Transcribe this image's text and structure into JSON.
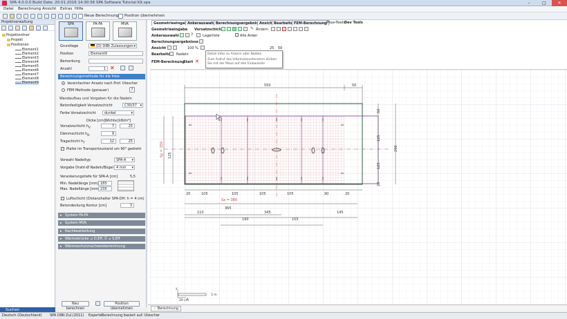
{
  "window": {
    "title": "SPA 4.0.0.0    Build Date: 20.01.2016 14:30:56    SPA Software Tutorial Kit.spa",
    "min": "–",
    "max": "□",
    "close": "✕"
  },
  "menu": [
    "Datei",
    "Berechnung",
    "Ansicht",
    "Extras",
    "Hilfe"
  ],
  "toolbar": {
    "new_calc": "Neue Berechnung",
    "take_position": "Position übernehmen"
  },
  "tree": {
    "header": "Projektverwaltung",
    "root": "Projektordner",
    "project": "Projekt",
    "positions": "Positionen",
    "elements": [
      "Element1",
      "Element2",
      "Element3",
      "Element4",
      "Element5",
      "Element6",
      "Element7",
      "Element8",
      "Element9"
    ]
  },
  "search_label": "Suchen",
  "systems": [
    {
      "label": "SPA"
    },
    {
      "label": "FA-FA"
    },
    {
      "label": "MVA"
    }
  ],
  "form": {
    "grundlage_label": "Grundlage",
    "grundlage_value": "(D) DIBt Zulassungen",
    "position_label": "Position",
    "position_value": "Element9",
    "bemerkung_label": "Bemerkung",
    "anzahl_label": "Anzahl",
    "anzahl_value": "1",
    "method_head": "Berechnungsmethode für die freie Verankerungen",
    "method_opt1": "Vereinfachter Ansatz nach Prof. Utescher",
    "method_opt2": "FEM Methode (genauer)",
    "method_help": "?",
    "wand_head": "Wandaufbau und Vorgaben für die Nadeln",
    "beton_label": "Betonfestigkeit Vorsatzschicht",
    "beton_value": "C30/37",
    "farbe_label": "Farbe Vorsatzschicht",
    "farbe_value": "dunkel",
    "dicke_head": "Dicke [cm]",
    "wichte_head": "Wichte",
    "wichte_unit": "[kN/m³]",
    "vs_label": "Vorsatzschicht   h",
    "vs_sub": "V",
    "vs_dicke": "7",
    "vs_wichte": "25",
    "dd_label": "Dämmschicht   h",
    "dd_sub": "D",
    "dd_dicke": "9",
    "ts_label": "Tragschicht   h",
    "ts_sub": "T",
    "ts_dicke": "12",
    "ts_wichte": "25",
    "platte_label": "Platte im Transportzustand um 90° gedreht",
    "nadeltyp_label": "Vorwahl Nadeltyp",
    "nadeltyp_value": "SPA-A",
    "draht_label": "Vorgabe Draht-Ø  Nadeln/Bügel",
    "draht_value": "4 mm",
    "veran_label": "Verankerungstiefe für SPA-A   [cm]",
    "veran_value": "5,5",
    "min_label": "Min. Nadellänge [mm]",
    "min_value": "185",
    "max_label": "Max. Nadellänge [mm]",
    "max_value": "235",
    "luft_label": "Luftschicht (Distanzhalter SPA-DH: h = 4 cm)",
    "kontur_label": "Betondeckung Kontur   [cm]",
    "kontur_value": "3",
    "sections": [
      "System FA-FA",
      "System MVA",
      "Nachbearbeitung",
      "Wärmebrücke   ⊿ D,Eff, Ü     ⊿ S,Eff",
      "Wärmeschutznachweisberechnung"
    ],
    "btn_new": "Neu berechnen",
    "btn_take": "Position übernehmen"
  },
  "ribbon": {
    "tabs": [
      "Geometrieeingabe",
      "Ankerauswahl",
      "Berechnungsergebnisse",
      "Ansicht",
      "Bearbeiten",
      "FEM-Berechnung",
      "Plus-Tools",
      "Dev Tools"
    ],
    "geo_label": "Geometrieeingabe",
    "vorsatz_label": "Vorsatzschicht",
    "aendern": "Ändern",
    "anker_label": "Ankerauswahl",
    "lagerliste": "Lagerliste",
    "alle_anker": "Alle Anker",
    "ergebnis_label": "Berechnungsergebnisse",
    "ansicht_label": "Ansicht",
    "zoom": "100 %",
    "zoom2": "25",
    "zoom3": "50",
    "bearbeiten_label": "Bearbeiten",
    "nadeln": "Nadeln",
    "fem_label": "FEM-Berechnung",
    "start": "Start",
    "tooltip_title": "Detail Infos zu Ankern oder Nadeln",
    "tooltip_text": "Zum Aufruf des Informationsfensters klicken Sie mit der Maus auf den Einbauteile"
  },
  "drawing": {
    "dim_top": "550",
    "dim_top_right": "50",
    "dim_right_top": "50",
    "dim_right_1": "125",
    "dim_right_2": "125",
    "dim_right_total": "290",
    "dim_right_bottom": "20",
    "dim_left_sy": "Sy = 150",
    "dim_left_2": "125",
    "bottom_dims": [
      "20",
      "105",
      "105",
      "105",
      "105",
      "90",
      "20"
    ],
    "sx": "Sx = 380",
    "d365": "365",
    "d110": "110",
    "d345": "345",
    "d145": "145",
    "d190": "190",
    "d155": "155",
    "scale_label": "1 m",
    "scale_small": "20 cm",
    "axis_y": "y",
    "axis_x": "x"
  },
  "bottom_tab": "Berechnung",
  "status": {
    "lang": "Deutsch (Deutschland)",
    "norm": "SPA DIBt Zul.(2011)",
    "mode": "Experte",
    "method": "Berechnung basiert auf:  Utescher"
  },
  "colors": {
    "accent": "#3f7fc6",
    "drawing_red": "#c24040",
    "drawing_green": "#2f9a3a",
    "drawing_purple": "#7e3b8e"
  }
}
